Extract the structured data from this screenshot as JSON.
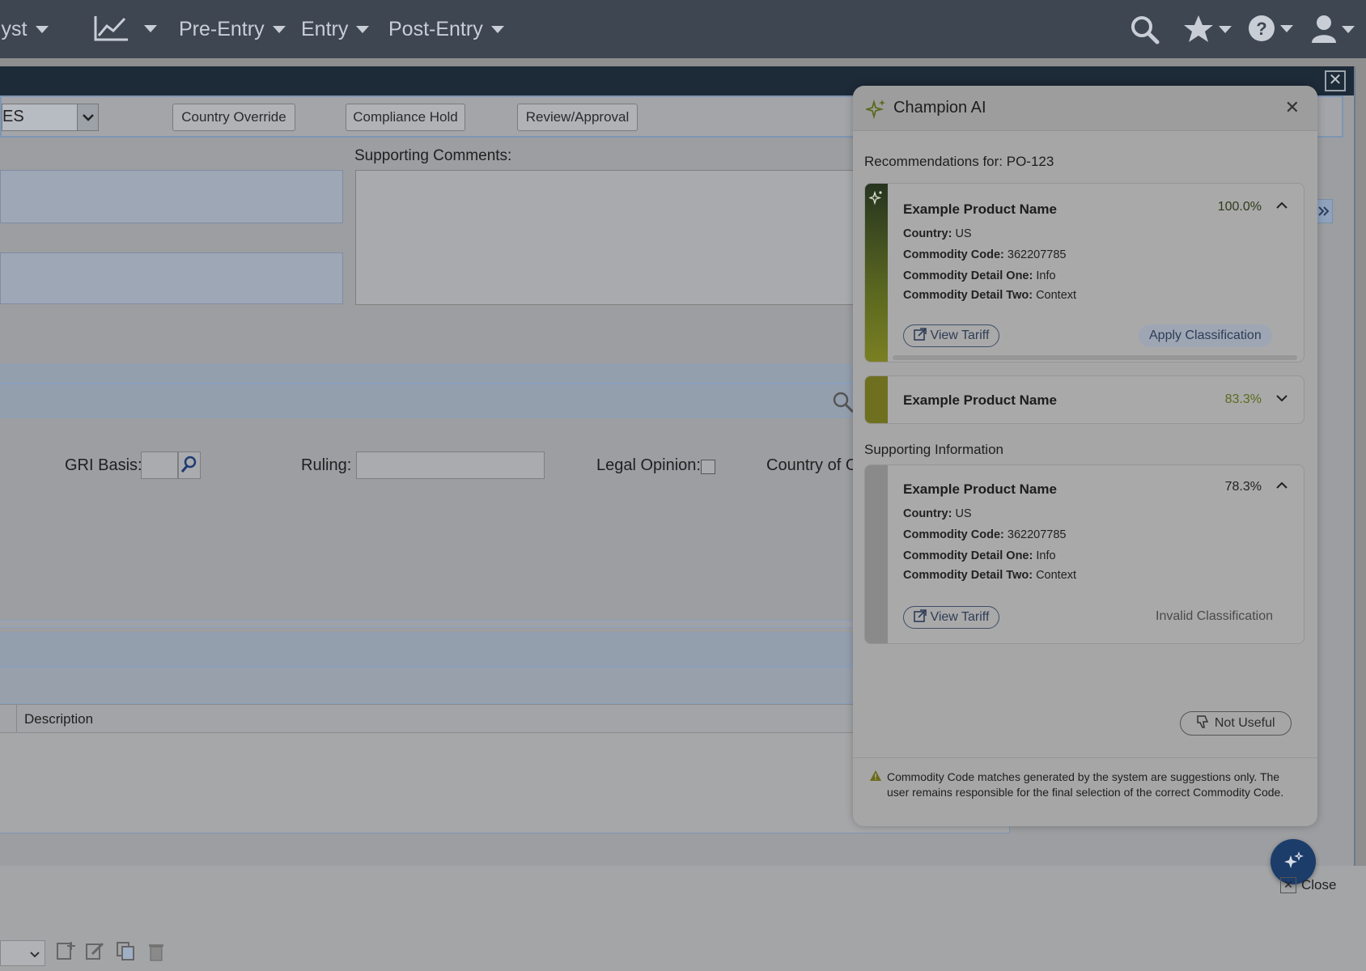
{
  "topnav": {
    "items": [
      {
        "label": "lyst"
      },
      {
        "label": "Pre-Entry"
      },
      {
        "label": "Entry"
      },
      {
        "label": "Post-Entry"
      }
    ],
    "icons": [
      "analytics-icon",
      "search-icon",
      "star-icon",
      "help-icon",
      "user-icon"
    ]
  },
  "toolbar": {
    "combo_value": "ES",
    "buttons": [
      "Country Override",
      "Compliance Hold",
      "Review/Approval"
    ]
  },
  "form": {
    "supporting_comments_label": "Supporting Comments:",
    "gri_basis_label": "GRI Basis:",
    "ruling_label": "Ruling:",
    "legal_opinion_label": "Legal Opinion:",
    "country_of_label": "Country of O"
  },
  "grid": {
    "columns": [
      "Description"
    ]
  },
  "champion": {
    "title": "Champion AI",
    "recommendations_for": "Recommendations for: PO-123",
    "supporting_information": "Supporting Information",
    "cards": [
      {
        "name": "Example Product Name",
        "score": "100.0%",
        "country_label": "Country:",
        "country": "US",
        "code_label": "Commodity Code:",
        "code": "362207785",
        "detail_one_label": "Commodity Detail One:",
        "detail_one": "Info",
        "detail_two_label": "Commodity Detail Two:",
        "detail_two": "Context",
        "view_tariff": "View Tariff",
        "action": "Apply Classification"
      },
      {
        "name": "Example Product Name",
        "score": "83.3%"
      },
      {
        "name": "Example Product Name",
        "score": "78.3%",
        "country_label": "Country:",
        "country": "US",
        "code_label": "Commodity Code:",
        "code": "362207785",
        "detail_one_label": "Commodity Detail One:",
        "detail_one": "Info",
        "detail_two_label": "Commodity Detail Two:",
        "detail_two": "Context",
        "view_tariff": "View Tariff",
        "status": "Invalid Classification"
      }
    ],
    "not_useful": "Not Useful",
    "disclaimer": "Commodity Code matches generated by the system are suggestions only. The user remains responsible for the final selection of the correct Commodity Code."
  },
  "window": {
    "close_label": "Close"
  },
  "colors": {
    "nav_bg": "#3e4652",
    "accent_blue": "#1c3c6a",
    "score_high": "#2f3a1c",
    "score_mid": "#5a6b1f"
  }
}
